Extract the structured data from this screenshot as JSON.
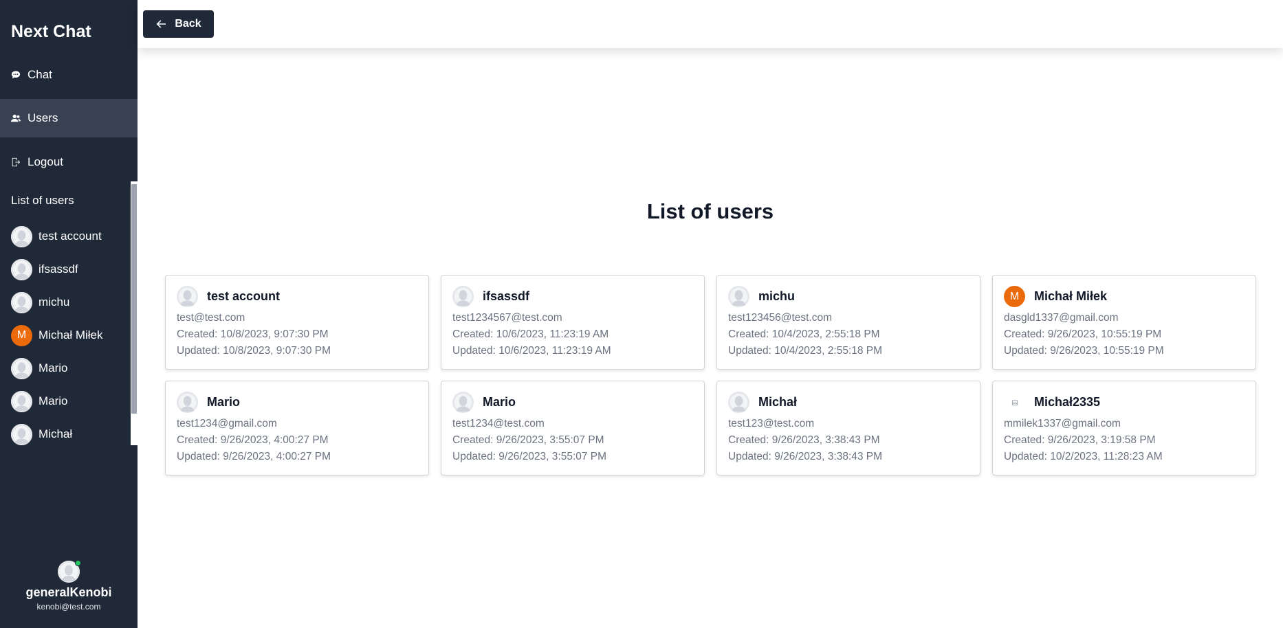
{
  "sidebar": {
    "brand": "Next Chat",
    "nav": [
      {
        "label": "Chat",
        "icon": "chat-icon"
      },
      {
        "label": "Users",
        "icon": "users-icon",
        "active": true
      },
      {
        "label": "Logout",
        "icon": "logout-icon"
      }
    ],
    "list_heading": "List of users",
    "users": [
      {
        "name": "test account",
        "avatar": "default"
      },
      {
        "name": "ifsassdf",
        "avatar": "default"
      },
      {
        "name": "michu",
        "avatar": "default"
      },
      {
        "name": "Michał Miłek",
        "avatar": "letter",
        "letter": "M"
      },
      {
        "name": "Mario",
        "avatar": "default"
      },
      {
        "name": "Mario",
        "avatar": "default"
      },
      {
        "name": "Michał",
        "avatar": "default"
      }
    ],
    "current_user": {
      "name": "generalKenobi",
      "email": "kenobi@test.com",
      "status": "online"
    }
  },
  "topbar": {
    "back_label": "Back"
  },
  "main": {
    "title": "List of users",
    "cards": [
      {
        "name": "test account",
        "email": "test@test.com",
        "created": "Created: 10/8/2023, 9:07:30 PM",
        "updated": "Updated: 10/8/2023, 9:07:30 PM",
        "avatar": "default"
      },
      {
        "name": "ifsassdf",
        "email": "test1234567@test.com",
        "created": "Created: 10/6/2023, 11:23:19 AM",
        "updated": "Updated: 10/6/2023, 11:23:19 AM",
        "avatar": "default"
      },
      {
        "name": "michu",
        "email": "test123456@test.com",
        "created": "Created: 10/4/2023, 2:55:18 PM",
        "updated": "Updated: 10/4/2023, 2:55:18 PM",
        "avatar": "default"
      },
      {
        "name": "Michał Miłek",
        "email": "dasgld1337@gmail.com",
        "created": "Created: 9/26/2023, 10:55:19 PM",
        "updated": "Updated: 9/26/2023, 10:55:19 PM",
        "avatar": "letter",
        "letter": "M"
      },
      {
        "name": "Mario",
        "email": "test1234@gmail.com",
        "created": "Created: 9/26/2023, 4:00:27 PM",
        "updated": "Updated: 9/26/2023, 4:00:27 PM",
        "avatar": "default"
      },
      {
        "name": "Mario",
        "email": "test1234@test.com",
        "created": "Created: 9/26/2023, 3:55:07 PM",
        "updated": "Updated: 9/26/2023, 3:55:07 PM",
        "avatar": "default"
      },
      {
        "name": "Michał",
        "email": "test123@test.com",
        "created": "Created: 9/26/2023, 3:38:43 PM",
        "updated": "Updated: 9/26/2023, 3:38:43 PM",
        "avatar": "default"
      },
      {
        "name": "Michał2335",
        "email": "mmilek1337@gmail.com",
        "created": "Created: 9/26/2023, 3:19:58 PM",
        "updated": "Updated: 10/2/2023, 11:28:23 AM",
        "avatar": "broken"
      }
    ]
  },
  "colors": {
    "sidebar_bg": "#1f2937",
    "active_nav_bg": "#374151",
    "accent_orange": "#ea6a0c",
    "online_green": "#22c55e"
  }
}
